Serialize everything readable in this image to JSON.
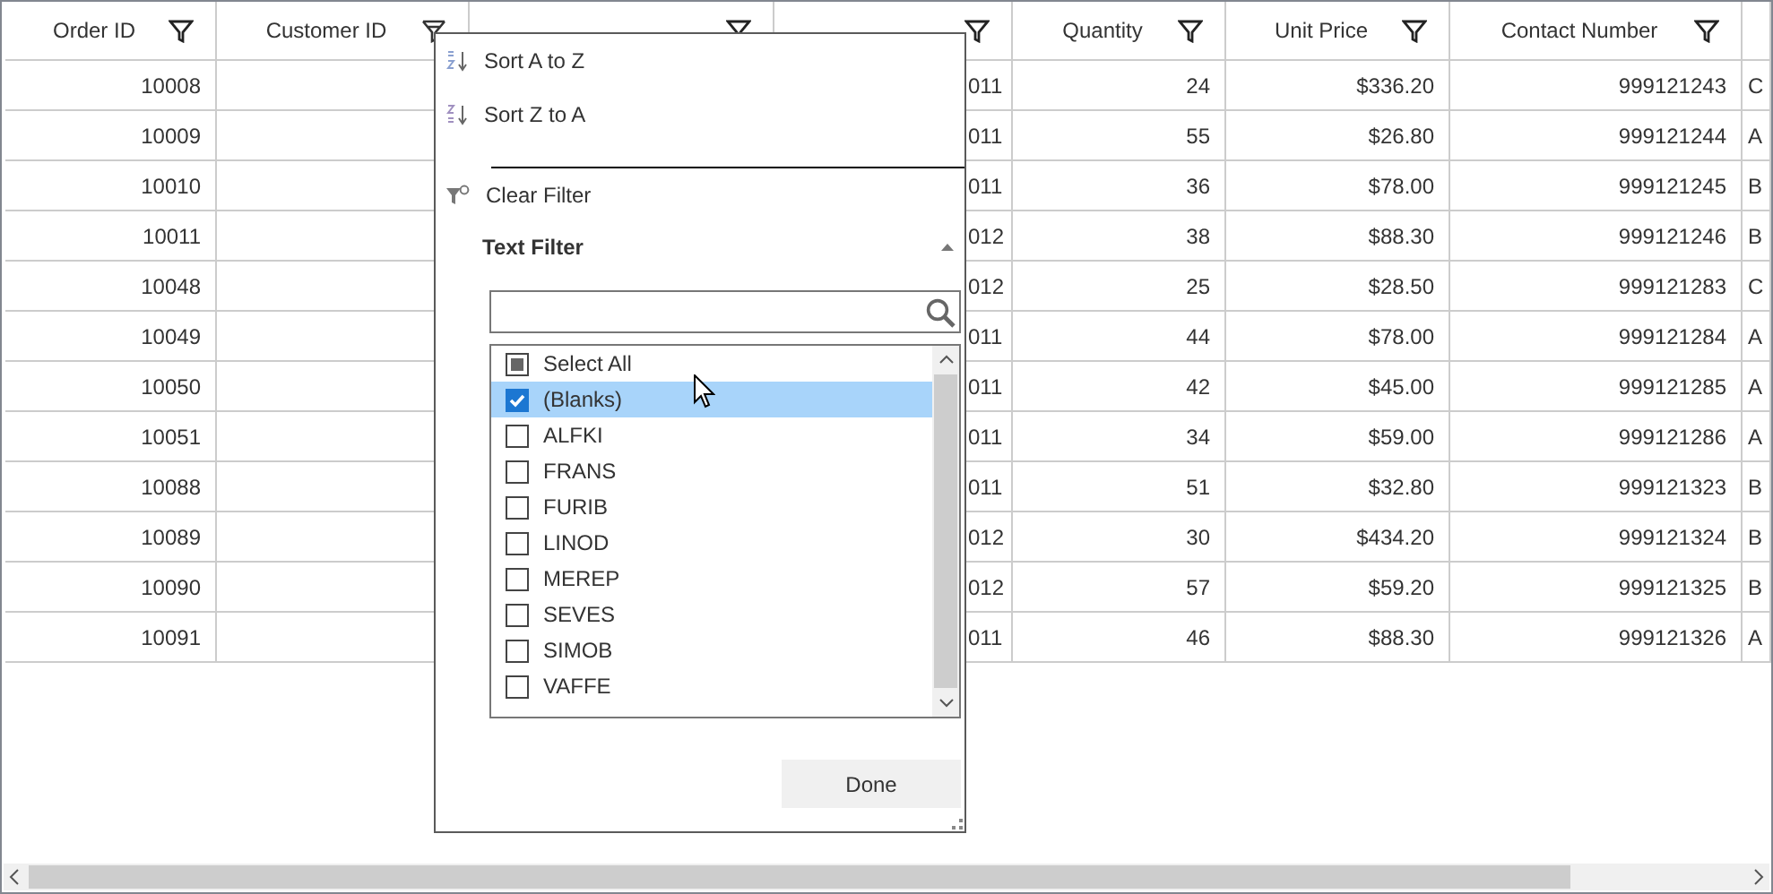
{
  "grid": {
    "columns": [
      {
        "label": "Order ID",
        "filtered": false
      },
      {
        "label": "Customer ID",
        "filtered": true
      },
      {
        "filtered": false
      },
      {
        "filtered": false
      },
      {
        "label": "Quantity",
        "filtered": false
      },
      {
        "label": "Unit Price",
        "filtered": false
      },
      {
        "label": "Contact Number",
        "filtered": false
      }
    ],
    "rows": [
      {
        "order_id": "10008",
        "order_date": "011",
        "quantity": "24",
        "unit_price": "$336.20",
        "contact_number": "999121243",
        "column_8": "C"
      },
      {
        "order_id": "10009",
        "order_date": "011",
        "quantity": "55",
        "unit_price": "$26.80",
        "contact_number": "999121244",
        "column_8": "A"
      },
      {
        "order_id": "10010",
        "order_date": "011",
        "quantity": "36",
        "unit_price": "$78.00",
        "contact_number": "999121245",
        "column_8": "B"
      },
      {
        "order_id": "10011",
        "order_date": "012",
        "quantity": "38",
        "unit_price": "$88.30",
        "contact_number": "999121246",
        "column_8": "B"
      },
      {
        "order_id": "10048",
        "order_date": "012",
        "quantity": "25",
        "unit_price": "$28.50",
        "contact_number": "999121283",
        "column_8": "C"
      },
      {
        "order_id": "10049",
        "order_date": "011",
        "quantity": "44",
        "unit_price": "$78.00",
        "contact_number": "999121284",
        "column_8": "A"
      },
      {
        "order_id": "10050",
        "order_date": "011",
        "quantity": "42",
        "unit_price": "$45.00",
        "contact_number": "999121285",
        "column_8": "A"
      },
      {
        "order_id": "10051",
        "order_date": "011",
        "quantity": "34",
        "unit_price": "$59.00",
        "contact_number": "999121286",
        "column_8": "A"
      },
      {
        "order_id": "10088",
        "order_date": "011",
        "quantity": "51",
        "unit_price": "$32.80",
        "contact_number": "999121323",
        "column_8": "B"
      },
      {
        "order_id": "10089",
        "order_date": "012",
        "quantity": "30",
        "unit_price": "$434.20",
        "contact_number": "999121324",
        "column_8": "B"
      },
      {
        "order_id": "10090",
        "order_date": "012",
        "quantity": "57",
        "unit_price": "$59.20",
        "contact_number": "999121325",
        "column_8": "B"
      },
      {
        "order_id": "10091",
        "order_date": "011",
        "quantity": "46",
        "unit_price": "$88.30",
        "contact_number": "999121326",
        "column_8": "A"
      }
    ]
  },
  "filter_popup": {
    "menu": [
      {
        "kind": "sort-asc",
        "label": "Sort A to Z"
      },
      {
        "kind": "sort-desc",
        "label": "Sort Z to A"
      },
      {
        "kind": "clear",
        "label": "Clear Filter"
      }
    ],
    "section_title": "Text Filter",
    "expanded": true,
    "values": [
      {
        "label": "Select All",
        "checked": false,
        "indeterminate": true,
        "selected": false
      },
      {
        "label": "(Blanks)",
        "checked": true,
        "indeterminate": false,
        "selected": true
      },
      {
        "label": "ALFKI",
        "checked": false,
        "indeterminate": false,
        "selected": false
      },
      {
        "label": "FRANS",
        "checked": false,
        "indeterminate": false,
        "selected": false
      },
      {
        "label": "FURIB",
        "checked": false,
        "indeterminate": false,
        "selected": false
      },
      {
        "label": "LINOD",
        "checked": false,
        "indeterminate": false,
        "selected": false
      },
      {
        "label": "MEREP",
        "checked": false,
        "indeterminate": false,
        "selected": false
      },
      {
        "label": "SEVES",
        "checked": false,
        "indeterminate": false,
        "selected": false
      },
      {
        "label": "SIMOB",
        "checked": false,
        "indeterminate": false,
        "selected": false
      },
      {
        "label": "VAFFE",
        "checked": false,
        "indeterminate": false,
        "selected": false
      }
    ],
    "done_button": "Done"
  }
}
